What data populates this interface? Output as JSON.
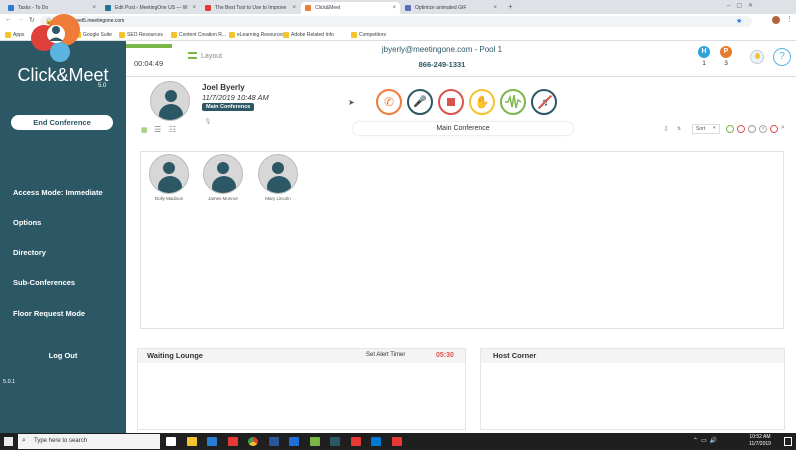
{
  "browser": {
    "tabs": [
      {
        "title": "Tasks - To Do",
        "color": "#2b7cd3"
      },
      {
        "title": "Edit Post ‹ MeetingOne US — W",
        "color": "#21759b"
      },
      {
        "title": "The Best Tool to Use to Improve",
        "color": "#e53935"
      },
      {
        "title": "Click&Meet",
        "color": "#f07c3a"
      },
      {
        "title": "Optimize animated GIF",
        "color": "#5c6bc0"
      }
    ],
    "url": "clickandmeet5.meetingone.com",
    "bookmarks": [
      "Apps",
      "MY Logins",
      "Google Suite",
      "SEO Resources",
      "Content Creation R...",
      "eLearning Resources",
      "Adobe Related Info",
      "Competitors"
    ]
  },
  "sidebar": {
    "brand": "Click&Meet",
    "version": "5.0",
    "end_conference": "End Conference",
    "menu": [
      "Access Mode: Immediate",
      "Options",
      "Directory",
      "Sub-Conferences",
      "Floor Request Mode"
    ],
    "logout": "Log Out",
    "app_version": "5.0.1"
  },
  "header": {
    "timer": "00:04:49",
    "layout_label": "Layout",
    "account": "jbyerly@meetingone.com - Pool 1",
    "phone": "866-249-1331",
    "badges": [
      {
        "letter": "H",
        "count": "1",
        "color": "#2ea3d8"
      },
      {
        "letter": "P",
        "count": "3",
        "color": "#e87a2f"
      }
    ]
  },
  "host": {
    "name": "Joel Byerly",
    "datetime": "11/7/2019  10:48 AM",
    "badge": "Main Conference"
  },
  "controls": [
    {
      "name": "dial-out-icon",
      "color": "#f07c3a"
    },
    {
      "name": "audio-mic-icon",
      "color": "#2c5866"
    },
    {
      "name": "stop-icon",
      "color": "#d9534f"
    },
    {
      "name": "raise-hand-icon",
      "color": "#f4c430"
    },
    {
      "name": "audio-wave-icon",
      "color": "#7ab648"
    },
    {
      "name": "mute-music-icon",
      "color": "#2c5866"
    }
  ],
  "conference": {
    "label": "Main Conference",
    "sort_value": "Sort",
    "participants": [
      "Dolly Madison",
      "James Monroe",
      "Mary Lincoln"
    ]
  },
  "waiting_lounge": {
    "title": "Waiting Lounge",
    "alert_label": "Set Alert Timer",
    "alert_value": "05:30"
  },
  "host_corner": {
    "title": "Host Corner"
  },
  "taskbar": {
    "search_placeholder": "Type here to search",
    "time": "10:52 AM",
    "date": "11/7/2019"
  }
}
